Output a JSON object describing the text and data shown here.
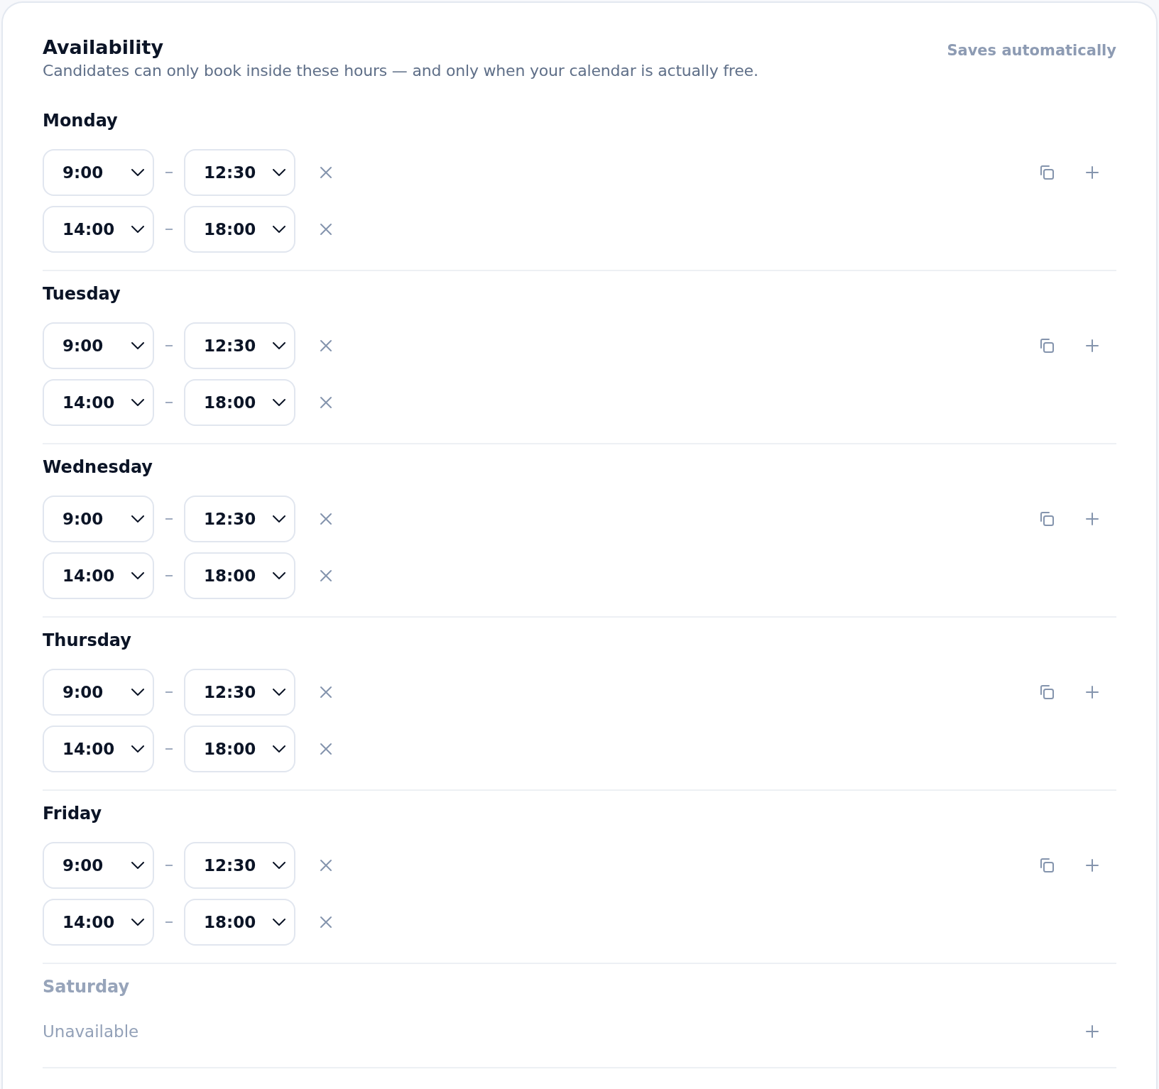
{
  "header": {
    "title": "Availability",
    "subtitle": "Candidates can only book inside these hours — and only when your calendar is actually free.",
    "save_status": "Saves automatically"
  },
  "days": [
    {
      "name": "Monday",
      "enabled": true,
      "slots": [
        {
          "start": "9:00",
          "end": "12:30"
        },
        {
          "start": "14:00",
          "end": "18:00"
        }
      ]
    },
    {
      "name": "Tuesday",
      "enabled": true,
      "slots": [
        {
          "start": "9:00",
          "end": "12:30"
        },
        {
          "start": "14:00",
          "end": "18:00"
        }
      ]
    },
    {
      "name": "Wednesday",
      "enabled": true,
      "slots": [
        {
          "start": "9:00",
          "end": "12:30"
        },
        {
          "start": "14:00",
          "end": "18:00"
        }
      ]
    },
    {
      "name": "Thursday",
      "enabled": true,
      "slots": [
        {
          "start": "9:00",
          "end": "12:30"
        },
        {
          "start": "14:00",
          "end": "18:00"
        }
      ]
    },
    {
      "name": "Friday",
      "enabled": true,
      "slots": [
        {
          "start": "9:00",
          "end": "12:30"
        },
        {
          "start": "14:00",
          "end": "18:00"
        }
      ]
    },
    {
      "name": "Saturday",
      "enabled": false,
      "empty_label": "Unavailable"
    }
  ]
}
